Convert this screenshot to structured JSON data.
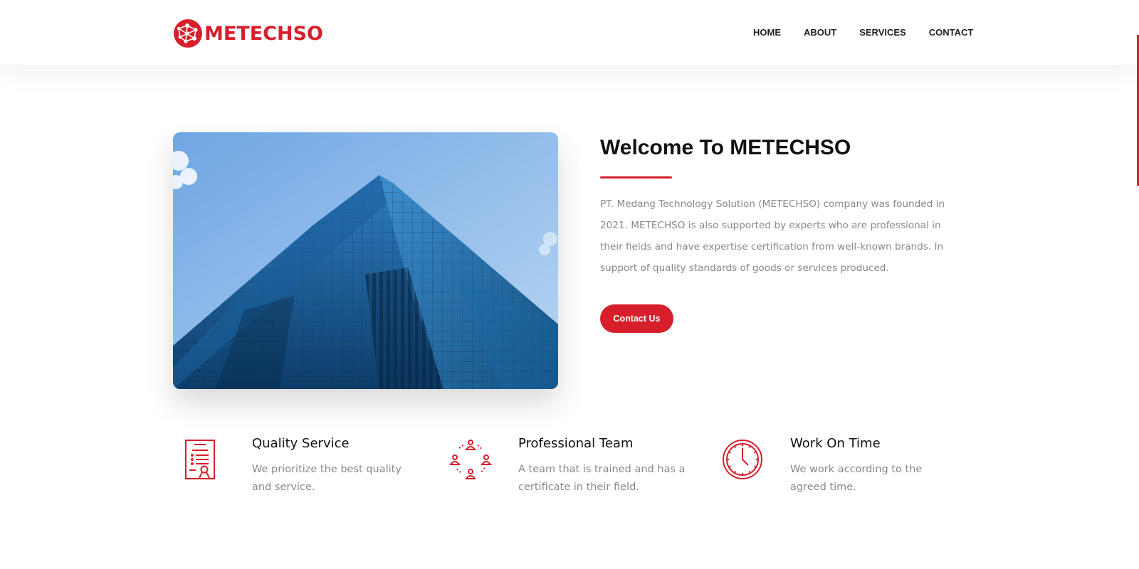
{
  "header": {
    "logo_text": "METECHSO",
    "nav": [
      {
        "label": "HOME"
      },
      {
        "label": "ABOUT"
      },
      {
        "label": "SERVICES"
      },
      {
        "label": "CONTACT"
      }
    ]
  },
  "hero": {
    "image_icon": "skyscraper-photo",
    "title": "Welcome To METECHSO",
    "description": "PT. Medang Technology Solution (METECHSO) company was founded in 2021. METECHSO is also supported by experts who are professional in their fields and have expertise certification from well-known brands. In support of quality standards of goods or services produced.",
    "button_label": "Contact Us"
  },
  "features": [
    {
      "icon": "certificate-icon",
      "title": "Quality Service",
      "description": "We prioritize the best quality and service."
    },
    {
      "icon": "team-network-icon",
      "title": "Professional Team",
      "description": "A team that is trained and has a certificate in their field."
    },
    {
      "icon": "clock-icon",
      "title": "Work On Time",
      "description": "We work according to the agreed time."
    }
  ],
  "colors": {
    "accent": "#d71f2c",
    "text": "#111111",
    "muted_text": "#888888"
  }
}
